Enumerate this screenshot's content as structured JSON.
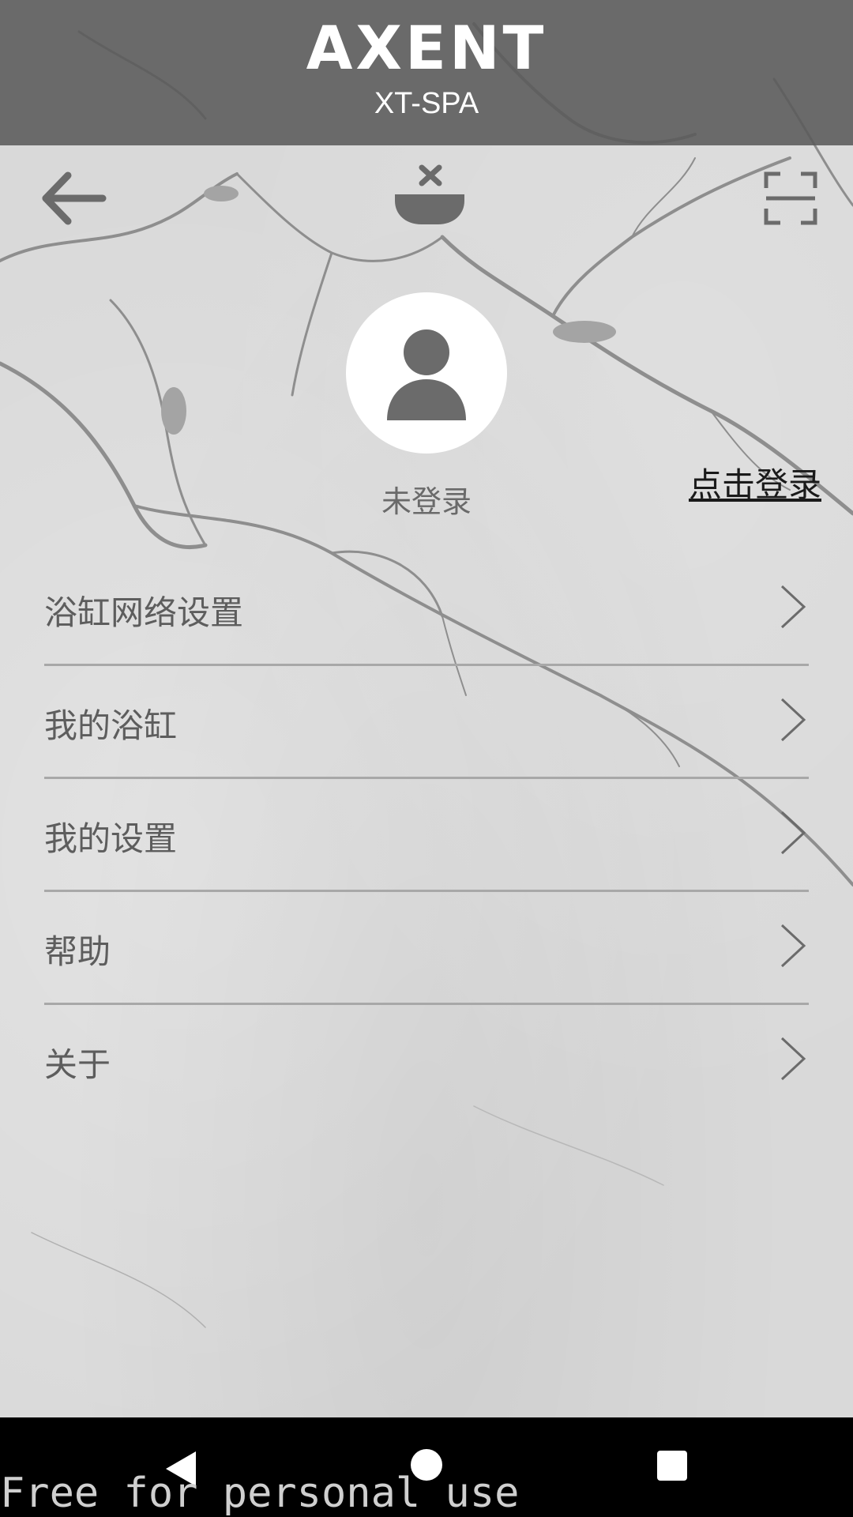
{
  "header": {
    "brand": "AXENT",
    "product": "XT-SPA"
  },
  "toolbar": {
    "back_icon": "arrow-left-icon",
    "device_icon": "bathtub-disconnected-icon",
    "scan_icon": "scan-frame-icon"
  },
  "profile": {
    "avatar_icon": "user-avatar-icon",
    "status": "未登录",
    "login_link": "点击登录"
  },
  "menu": {
    "items": [
      {
        "label": "浴缸网络设置"
      },
      {
        "label": "我的浴缸"
      },
      {
        "label": "我的设置"
      },
      {
        "label": "帮助"
      },
      {
        "label": "关于"
      }
    ]
  },
  "system_nav": {
    "back_icon": "triangle-back-icon",
    "home_icon": "circle-home-icon",
    "recent_icon": "square-recent-icon"
  },
  "watermark": "Free for personal use",
  "colors": {
    "header_bg": "#5a5a5a",
    "background": "#d9d9d9",
    "text_gray": "#5d5d5d",
    "icon_gray": "#6b6b6b"
  }
}
